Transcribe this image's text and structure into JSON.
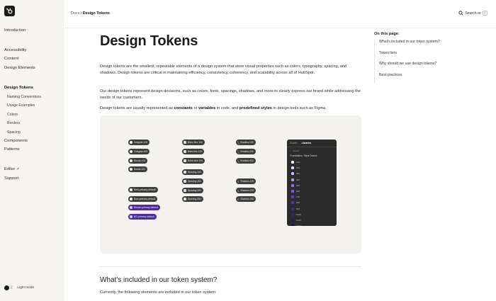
{
  "sidebar": {
    "items": [
      {
        "label": "Introduction",
        "level": 0,
        "active": false
      },
      {
        "label": "Accessibility",
        "level": 0,
        "active": false
      },
      {
        "label": "Content",
        "level": 0,
        "active": false
      },
      {
        "label": "Design Elements",
        "level": 0,
        "active": false
      },
      {
        "label": "Design Tokens",
        "level": 0,
        "active": true
      },
      {
        "label": "Naming Conventions",
        "level": 1,
        "active": false
      },
      {
        "label": "Usage Examples",
        "level": 1,
        "active": false
      },
      {
        "label": "Colors",
        "level": 1,
        "active": false
      },
      {
        "label": "Borders",
        "level": 1,
        "active": false
      },
      {
        "label": "Spacing",
        "level": 1,
        "active": false
      },
      {
        "label": "Components",
        "level": 0,
        "active": false
      },
      {
        "label": "Patterns",
        "level": 0,
        "active": false
      },
      {
        "label": "Editor",
        "level": 0,
        "active": false,
        "external": true
      },
      {
        "label": "Support",
        "level": 0,
        "active": false
      }
    ],
    "mode_label": "Light mode"
  },
  "header": {
    "breadcrumb_parent": "Docs",
    "breadcrumb_sep": "/",
    "breadcrumb_current": "Design Tokens",
    "search_label": "Search or",
    "search_shortcut": "/"
  },
  "main": {
    "title": "Design Tokens",
    "para1": "Design tokens are the smallest, repeatable elements of a design system that store visual properties such as colors, typography, spacing, and shadows. Design tokens are critical in maintaining efficiency, consistency, coherency, and scalability across all of HubSpot.",
    "para2": "Our design tokens represent design decisions, such as colors, fonts, spacings, shadows, and more to clearly express our brand while addressing the needs of our customers.",
    "para3": {
      "a": "Design tokens are usually represented as ",
      "b": "constants",
      "c": " or ",
      "d": "variables",
      "e": " in code, and ",
      "f": "predefined styles",
      "g": " in design tools such as Figma."
    },
    "h2": "What's included in our token system?",
    "para4": "Currently, the following elements are included in our token system:"
  },
  "figure": {
    "chips_col1": [
      "Grisglas-100",
      "Grisglas-400",
      "Boxdy-100",
      "Bowal-100"
    ],
    "chips_col1b": [
      "Best-primary-default",
      "Bow-primary-default",
      "Border-primary-default",
      "BG-primary-default"
    ],
    "chips_col2": [
      "Bdev-line-100",
      "Bder-line-100",
      "Bdeb-line-100"
    ],
    "chips_col2b": [
      "Spacing-100",
      "Spacing-200",
      "Spacing-300",
      "Spacing-400"
    ],
    "chips_col3": [
      "Bradius-100",
      "Bradius-200",
      "Bradius-400"
    ],
    "chips_col3b": [
      "Shadow-100",
      "Shadow-200",
      "Shadow-300"
    ],
    "panel": {
      "tab1": "Charter",
      "tab2": "Libraries",
      "search": "Search",
      "crumb_a": "Foundations",
      "crumb_b": "Base Tokens",
      "rows": [
        "100",
        "200",
        "300",
        "400",
        "500",
        "600",
        "700",
        "800",
        "900",
        "1000",
        "1100",
        "1200"
      ]
    },
    "colors": [
      "#f2eefc",
      "#e2d9fa",
      "#cbbcf5",
      "#b09cef",
      "#9478e8",
      "#7a57df",
      "#6440cf",
      "#5433b3",
      "#452a93",
      "#372174",
      "#2a1959",
      "#1e1240"
    ]
  },
  "toc": {
    "title": "On this page:",
    "items": [
      "What's included in our token system?",
      "Token tiers",
      "Why should we use design tokens?",
      "Best practices"
    ]
  }
}
